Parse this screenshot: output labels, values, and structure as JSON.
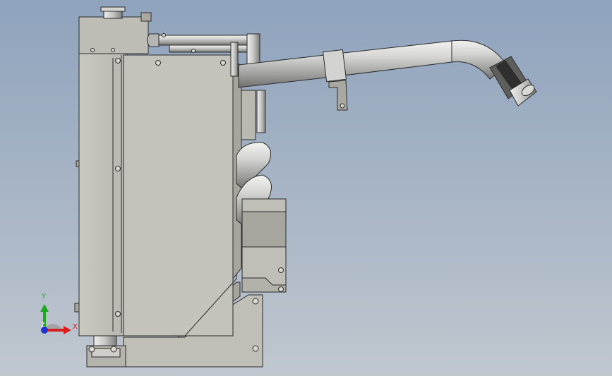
{
  "triad": {
    "x_label": "X",
    "y_label": "Y",
    "z_label": "Z",
    "x_color": "#d91c1c",
    "y_color": "#20a820",
    "z_color": "#2035d0"
  },
  "colors": {
    "background_top": "#8fa3bd",
    "background_bottom": "#c0c7cf",
    "metal_face": "#bebdb5",
    "metal_dark": "#9c9b93",
    "pipe_light": "#e8e8e6",
    "pipe_dark": "#7c7c7a",
    "edge": "#2b2b2b"
  }
}
